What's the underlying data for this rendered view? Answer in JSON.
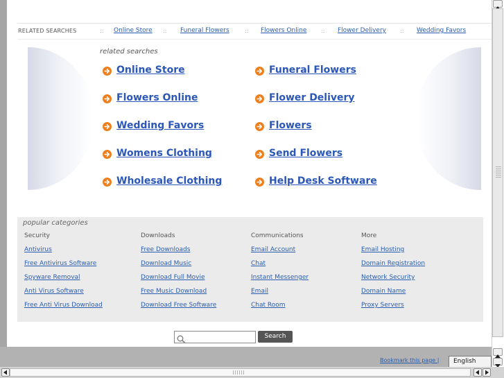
{
  "related_bar": {
    "label": "RELATED SEARCHES",
    "separator": "::",
    "links": [
      "Online Store",
      "Funeral Flowers",
      "Flowers Online",
      "Flower Delivery",
      "Wedding Favors"
    ]
  },
  "related_searches": {
    "title": "related searches",
    "items": [
      "Online Store",
      "Funeral Flowers",
      "Flowers Online",
      "Flower Delivery",
      "Wedding Favors",
      "Flowers",
      "Womens Clothing",
      "Send Flowers",
      "Wholesale Clothing",
      "Help Desk Software"
    ],
    "arrow_icon": "arrow-right-circle-icon",
    "arrow_color": "#ee7f1a",
    "link_color": "#2a57b8"
  },
  "popular_categories": {
    "title": "popular categories",
    "columns": [
      {
        "title": "Security",
        "links": [
          "Antivirus",
          "Free Antivirus Software",
          "Spyware Removal",
          "Anti Virus Software",
          "Free Anti Virus Download"
        ]
      },
      {
        "title": "Downloads",
        "links": [
          "Free Downloads",
          "Download Music",
          "Download Full Movie",
          "Free Music Download",
          "Download Free Software"
        ]
      },
      {
        "title": "Communications",
        "links": [
          "Email Account",
          "Chat",
          "Instant Messenger",
          "Email",
          "Chat Room"
        ]
      },
      {
        "title": "More",
        "links": [
          "Email Hosting",
          "Domain Registration",
          "Network Security",
          "Domain Name",
          "Proxy Servers"
        ]
      }
    ]
  },
  "search": {
    "placeholder": "",
    "button_label": "Search",
    "icon": "magnifier-icon"
  },
  "footer": {
    "bookmark_label": "Bookmark this page |",
    "language": "English"
  }
}
